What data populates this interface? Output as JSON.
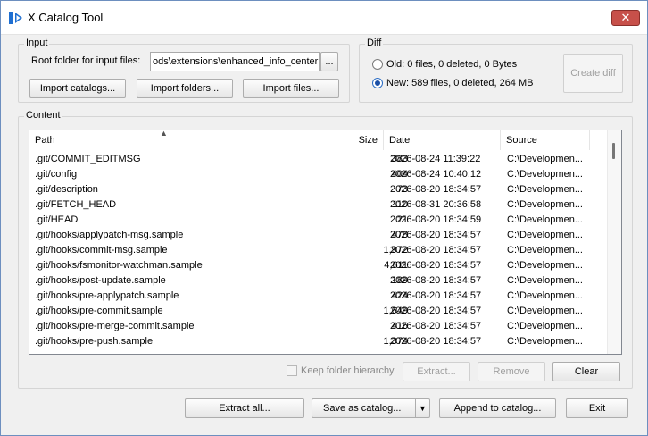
{
  "window": {
    "title": "X Catalog Tool",
    "close_symbol": "✕"
  },
  "input": {
    "group_label": "Input",
    "root_label": "Root folder for input files:",
    "root_value": "ods\\extensions\\enhanced_info_center",
    "browse_label": "...",
    "import_catalogs": "Import catalogs...",
    "import_folders": "Import folders...",
    "import_files": "Import files..."
  },
  "diff": {
    "group_label": "Diff",
    "old_label": "Old: 0 files, 0 deleted, 0 Bytes",
    "new_label": "New: 589 files, 0 deleted, 264 MB",
    "create_diff": "Create diff"
  },
  "content": {
    "group_label": "Content",
    "columns": {
      "path": "Path",
      "size": "Size",
      "date": "Date",
      "source": "Source"
    },
    "rows": [
      {
        "path": ".git/COMMIT_EDITMSG",
        "size": "383",
        "date": "2026-08-24 11:39:22",
        "source": "C:\\Developmen..."
      },
      {
        "path": ".git/config",
        "size": "404",
        "date": "2026-08-24 10:40:12",
        "source": "C:\\Developmen..."
      },
      {
        "path": ".git/description",
        "size": "73",
        "date": "2026-08-20 18:34:57",
        "source": "C:\\Developmen..."
      },
      {
        "path": ".git/FETCH_HEAD",
        "size": "110",
        "date": "2026-08-31 20:36:58",
        "source": "C:\\Developmen..."
      },
      {
        "path": ".git/HEAD",
        "size": "21",
        "date": "2026-08-20 18:34:59",
        "source": "C:\\Developmen..."
      },
      {
        "path": ".git/hooks/applypatch-msg.sample",
        "size": "478",
        "date": "2026-08-20 18:34:57",
        "source": "C:\\Developmen..."
      },
      {
        "path": ".git/hooks/commit-msg.sample",
        "size": "1,972",
        "date": "2026-08-20 18:34:57",
        "source": "C:\\Developmen..."
      },
      {
        "path": ".git/hooks/fsmonitor-watchman.sample",
        "size": "4,611",
        "date": "2026-08-20 18:34:57",
        "source": "C:\\Developmen..."
      },
      {
        "path": ".git/hooks/post-update.sample",
        "size": "189",
        "date": "2026-08-20 18:34:57",
        "source": "C:\\Developmen..."
      },
      {
        "path": ".git/hooks/pre-applypatch.sample",
        "size": "424",
        "date": "2026-08-20 18:34:57",
        "source": "C:\\Developmen..."
      },
      {
        "path": ".git/hooks/pre-commit.sample",
        "size": "1,649",
        "date": "2026-08-20 18:34:57",
        "source": "C:\\Developmen..."
      },
      {
        "path": ".git/hooks/pre-merge-commit.sample",
        "size": "416",
        "date": "2026-08-20 18:34:57",
        "source": "C:\\Developmen..."
      },
      {
        "path": ".git/hooks/pre-push.sample",
        "size": "1,374",
        "date": "2026-08-20 18:34:57",
        "source": "C:\\Developmen..."
      }
    ],
    "keep_hierarchy": "Keep folder hierarchy",
    "extract": "Extract...",
    "remove": "Remove",
    "clear": "Clear"
  },
  "footer": {
    "extract_all": "Extract all...",
    "save_as_catalog": "Save as catalog...",
    "append_to_catalog": "Append to catalog...",
    "exit": "Exit"
  },
  "colors": {
    "accent": "#1a4fa6",
    "close_button": "#c7504a"
  }
}
